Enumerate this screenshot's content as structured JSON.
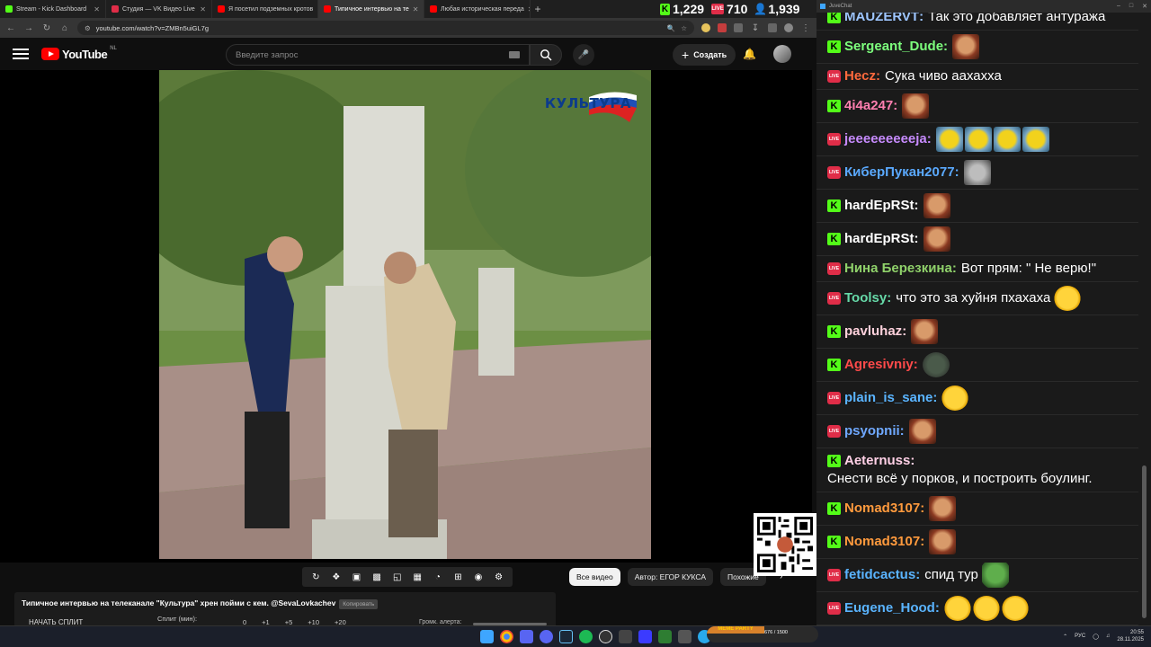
{
  "browser": {
    "tabs": [
      {
        "title": "Stream - Kick Dashboard",
        "color": "#53fc18",
        "active": false
      },
      {
        "title": "Студия — VK Видео Live",
        "color": "#e02d48",
        "active": false
      },
      {
        "title": "Я посетил подземных кротов",
        "color": "#ff0000",
        "active": false
      },
      {
        "title": "Типичное интервью на те",
        "color": "#ff0000",
        "active": true
      },
      {
        "title": "Любая историческая переда",
        "color": "#ff0000",
        "active": false
      }
    ],
    "url": "youtube.com/watch?v=ZMBn5uiGL7g"
  },
  "stream_stats": {
    "kick_viewers": "1,229",
    "vk_label": "LIVE",
    "vk_viewers": "710",
    "youtube_viewers": "1,939"
  },
  "youtube": {
    "logo_text": "YouTube",
    "country": "NL",
    "search_placeholder": "Введите запрос",
    "create_label": "Создать",
    "video_watermark": "КУЛЬТУРА",
    "video_title": "Типичное интервью на телеканале \"Культура\" хрен пойми с кем. @SevaLovkachev",
    "title_badge": "Копировать",
    "split_button": "НАЧАТЬ СПЛИТ",
    "split_label": "Сплит (мин):",
    "split_values": [
      "0",
      "+1",
      "+5",
      "+10",
      "+20"
    ],
    "volume_label": "Громк. алерта:",
    "chips": [
      "Все видео",
      "Автор: ЕГОР КУКСА",
      "Похожие"
    ],
    "active_chip": "Все видео"
  },
  "chat": {
    "window_title": "JuveChat",
    "messages": [
      {
        "platform": "kick",
        "user": "MAUZERVT",
        "color": "#9ec6ff",
        "text": "Так это добавляет антуража",
        "emotes": []
      },
      {
        "platform": "kick",
        "user": "Sergeant_Dude",
        "color": "#7dff7d",
        "text": "",
        "emotes": [
          "face"
        ]
      },
      {
        "platform": "vk",
        "user": "Hecz",
        "color": "#ff6a3d",
        "text": "Сука чиво аахахха",
        "emotes": []
      },
      {
        "platform": "kick",
        "user": "4i4a247",
        "color": "#ff7fb0",
        "text": "",
        "emotes": [
          "face"
        ]
      },
      {
        "platform": "vk",
        "user": "jeeeeeeeeeja",
        "color": "#c78bff",
        "text": "",
        "emotes": [
          "duck",
          "duck",
          "duck",
          "duck"
        ]
      },
      {
        "platform": "vk",
        "user": "КиберПукан2077",
        "color": "#5aa9ff",
        "text": "",
        "emotes": [
          "cat"
        ]
      },
      {
        "platform": "kick",
        "user": "hardEpRSt",
        "color": "#ffffff",
        "text": "",
        "emotes": [
          "face"
        ]
      },
      {
        "platform": "kick",
        "user": "hardEpRSt",
        "color": "#ffffff",
        "text": "",
        "emotes": [
          "face"
        ]
      },
      {
        "platform": "vk",
        "user": "Нина Березкина",
        "color": "#8fd16a",
        "text": "Вот прям: \" Не верю!\"",
        "emotes": []
      },
      {
        "platform": "vk",
        "user": "Toolsy",
        "color": "#66d9a8",
        "text": "что это за хуйня пхахаха",
        "emotes": [
          "laugh"
        ]
      },
      {
        "platform": "kick",
        "user": "pavluhaz",
        "color": "#ffd1dc",
        "text": "",
        "emotes": [
          "face"
        ]
      },
      {
        "platform": "kick",
        "user": "Agresivniy",
        "color": "#ff4a4a",
        "text": "",
        "emotes": [
          "dark"
        ]
      },
      {
        "platform": "vk",
        "user": "plain_is_sane",
        "color": "#5ab4ff",
        "text": "",
        "emotes": [
          "laugh"
        ]
      },
      {
        "platform": "vk",
        "user": "psyopnii",
        "color": "#6fa8ff",
        "text": "",
        "emotes": [
          "face"
        ]
      },
      {
        "platform": "kick",
        "user": "Aeternuss",
        "color": "#ffd0e6",
        "text": "Снести всё у порков, и построить боулинг.",
        "emotes": []
      },
      {
        "platform": "kick",
        "user": "Nomad3107",
        "color": "#ff9a3d",
        "text": "",
        "emotes": [
          "face"
        ]
      },
      {
        "platform": "kick",
        "user": "Nomad3107",
        "color": "#ff9a3d",
        "text": "",
        "emotes": [
          "face"
        ]
      },
      {
        "platform": "vk",
        "user": "fetidcactus",
        "color": "#5ab4ff",
        "text": "спид тур",
        "emotes": [
          "pepe"
        ]
      },
      {
        "platform": "vk",
        "user": "Eugene_Hood",
        "color": "#5ab4ff",
        "text": "",
        "emotes": [
          "laugh",
          "laugh",
          "laugh"
        ]
      }
    ]
  },
  "widget": {
    "title": "MEME PARTY",
    "progress_text": "676 / 1500"
  },
  "taskbar": {
    "language": "РУС",
    "time": "20:55",
    "date": "28.11.2025"
  }
}
